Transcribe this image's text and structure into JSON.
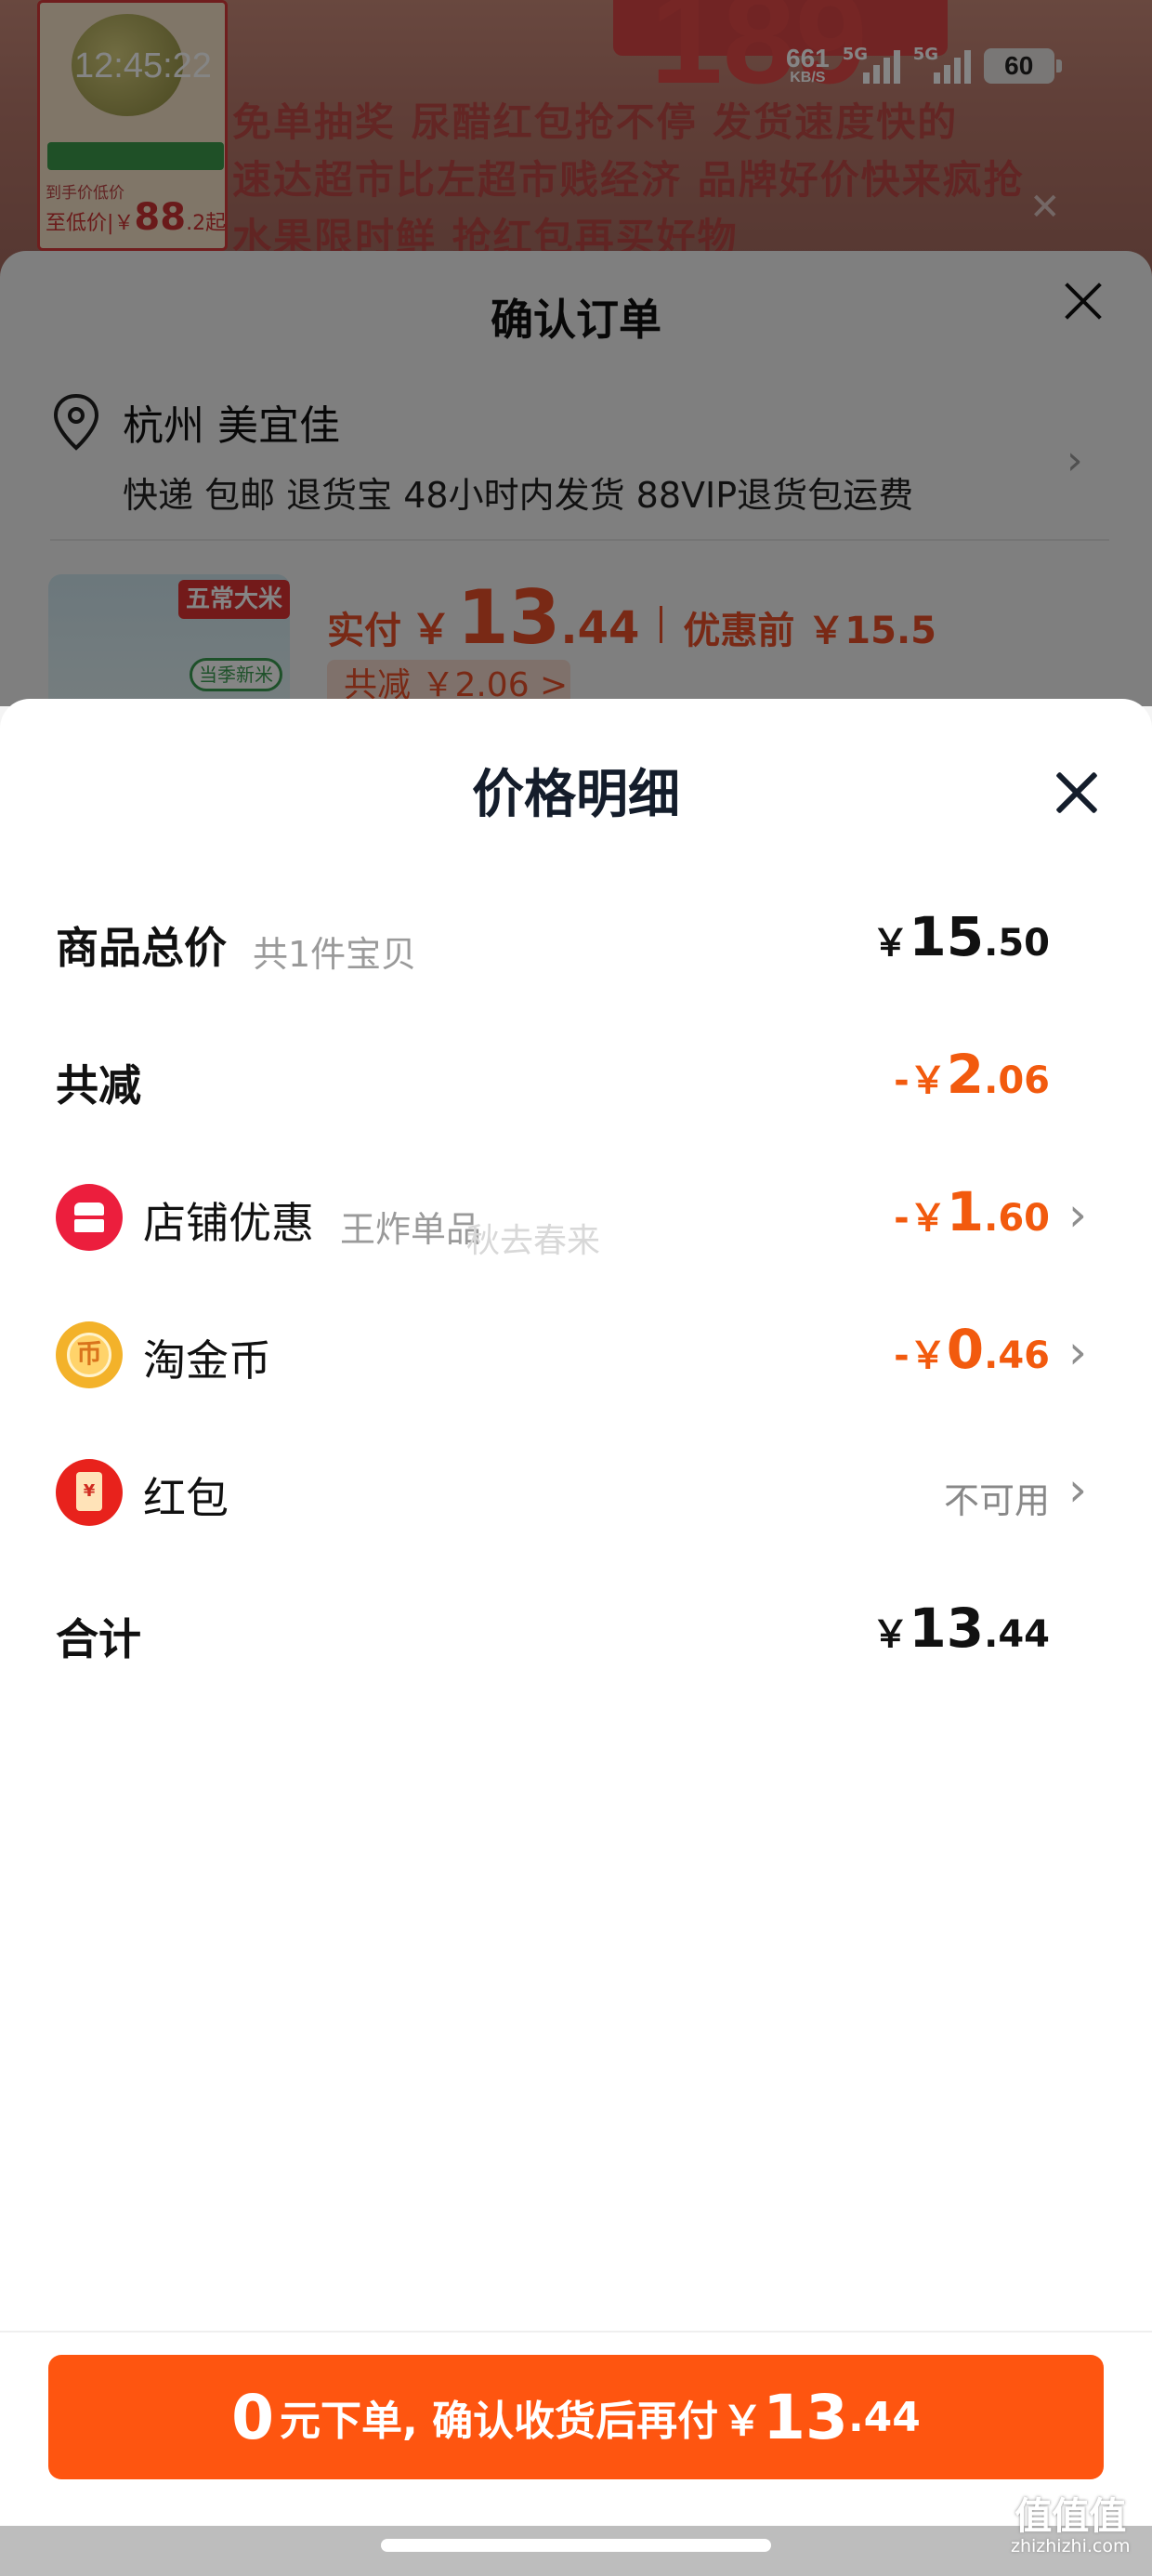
{
  "status_bar": {
    "time": "12:45:22",
    "net_speed": "661",
    "net_unit": "KB/S",
    "signal1": "5G",
    "signal2": "5G",
    "battery": "60"
  },
  "background_banner": {
    "line1": "免单抽奖   尿醋红包抢不停   发货速度快的",
    "line2": "速达超市比左超市贱经济   品牌好价快来疯抢",
    "line3": "水果限时鲜   抢红包再买好物",
    "thumb_small": "到手价低价",
    "thumb_price_prefix": "至低价|￥",
    "thumb_price": "88",
    "thumb_price_suffix": ".2起"
  },
  "order_sheet": {
    "title": "确认订单",
    "address_name": "杭州 美宜佳",
    "address_detail": "快递 包邮 退货宝 48小时内发货 88VIP退货包运费",
    "product_tag1": "五常大米",
    "product_tag2": "当季新米",
    "pay_label": "实付",
    "pay_yen": "￥",
    "pay_int": "13",
    "pay_dec": ".44",
    "before_label": "优惠前 ￥15.5",
    "save_chip": "共减 ￥2.06 >"
  },
  "modal": {
    "title": "价格明细",
    "rows": {
      "total": {
        "label": "商品总价",
        "sub": "共1件宝贝",
        "yen": "￥",
        "int": "15",
        "dec": ".50"
      },
      "reduce": {
        "label": "共减",
        "yen": "-￥",
        "int": "2",
        "dec": ".06"
      },
      "shop": {
        "label": "店铺优惠",
        "sub": "王炸单品",
        "yen": "-￥",
        "int": "1",
        "dec": ".60"
      },
      "coin": {
        "label": "淘金币",
        "icon_glyph": "币",
        "yen": "-￥",
        "int": "0",
        "dec": ".46"
      },
      "redpack": {
        "label": "红包",
        "icon_glyph": "¥",
        "value": "不可用"
      },
      "sum": {
        "label": "合计",
        "yen": "￥",
        "int": "13",
        "dec": ".44"
      }
    },
    "watermark": "秋去春来"
  },
  "bottom": {
    "cta_zero": "0",
    "cta_text": "元下单, 确认收货后再付",
    "cta_yen": "￥",
    "cta_int": "13",
    "cta_dec": ".44"
  },
  "site_logo": {
    "glyphs": "值值值",
    "url": "zhizhizhi.com"
  },
  "colors": {
    "accent_orange": "#fe5510",
    "discount_orange": "#f25a0e",
    "shop_red": "#ec1e3d",
    "coin_gold": "#f3b22a"
  },
  "icons": [
    "location-pin-icon",
    "close-icon",
    "chevron-right-icon",
    "shop-icon",
    "coin-icon",
    "red-packet-icon"
  ]
}
